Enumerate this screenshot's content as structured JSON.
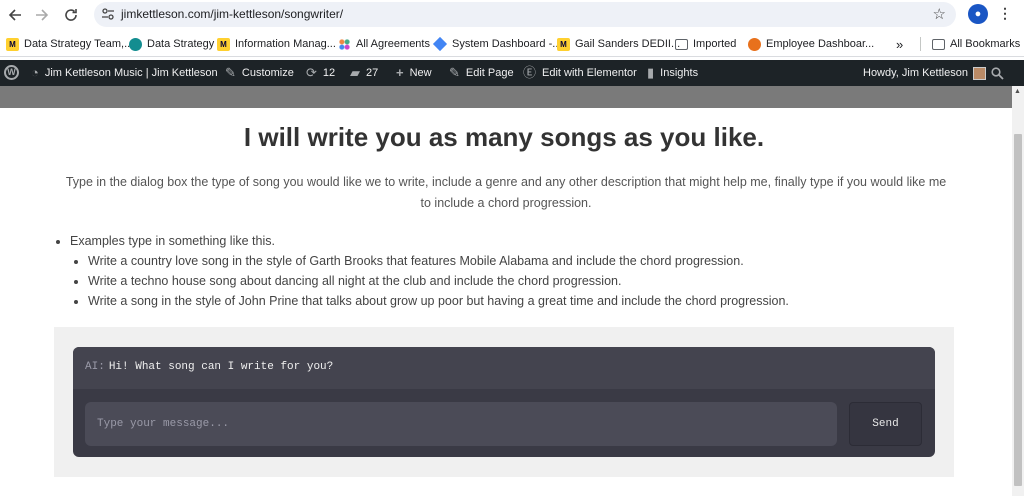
{
  "browser": {
    "url": "jimkettleson.com/jim-kettleson/songwriter/",
    "bookmarks": [
      {
        "label": "Data Strategy Team,...",
        "icon": "miro-icon"
      },
      {
        "label": "Data Strategy",
        "icon": "sharepoint-icon"
      },
      {
        "label": "Information Manag...",
        "icon": "miro-icon"
      },
      {
        "label": "All Agreements",
        "icon": "agreements-icon"
      },
      {
        "label": "System Dashboard -...",
        "icon": "jira-icon"
      },
      {
        "label": "Gail Sanders DEDII...",
        "icon": "miro-icon"
      },
      {
        "label": "Imported",
        "icon": "folder-icon"
      },
      {
        "label": "Employee Dashboar...",
        "icon": "orange-circle-icon"
      }
    ],
    "overflow_label": "»",
    "all_bookmarks_label": "All Bookmarks"
  },
  "wp_admin_bar": {
    "site_name": "Jim Kettleson Music | Jim Kettleson",
    "customize": "Customize",
    "updates_count": "12",
    "comments_count": "27",
    "new_label": "New",
    "edit_page": "Edit Page",
    "edit_elementor": "Edit with Elementor",
    "insights": "Insights",
    "greeting": "Howdy, Jim Kettleson"
  },
  "page": {
    "title": "I will write you as many songs as you like.",
    "intro": "Type in the dialog box the type of song you would like we to write, include a genre and any other description that might help me, finally type if you would like me to include a chord progression.",
    "examples_heading": "Examples type in something like this.",
    "examples": [
      "Write a country love song in the style of Garth Brooks that features Mobile Alabama and include the chord progression.",
      "Write a techno house song about dancing all night at the club and include the chord progression.",
      "Write a song in the style of John Prine that talks about grow up poor but having a great time and include the chord progression."
    ]
  },
  "chat": {
    "ai_prefix": "AI:",
    "ai_message": "Hi! What song can I write for you?",
    "input_placeholder": "Type your message...",
    "send_label": "Send"
  },
  "colors": {
    "wp_bar": "#1d2327",
    "chat_bg": "#3a3a45",
    "chat_input": "#4b4b57"
  }
}
